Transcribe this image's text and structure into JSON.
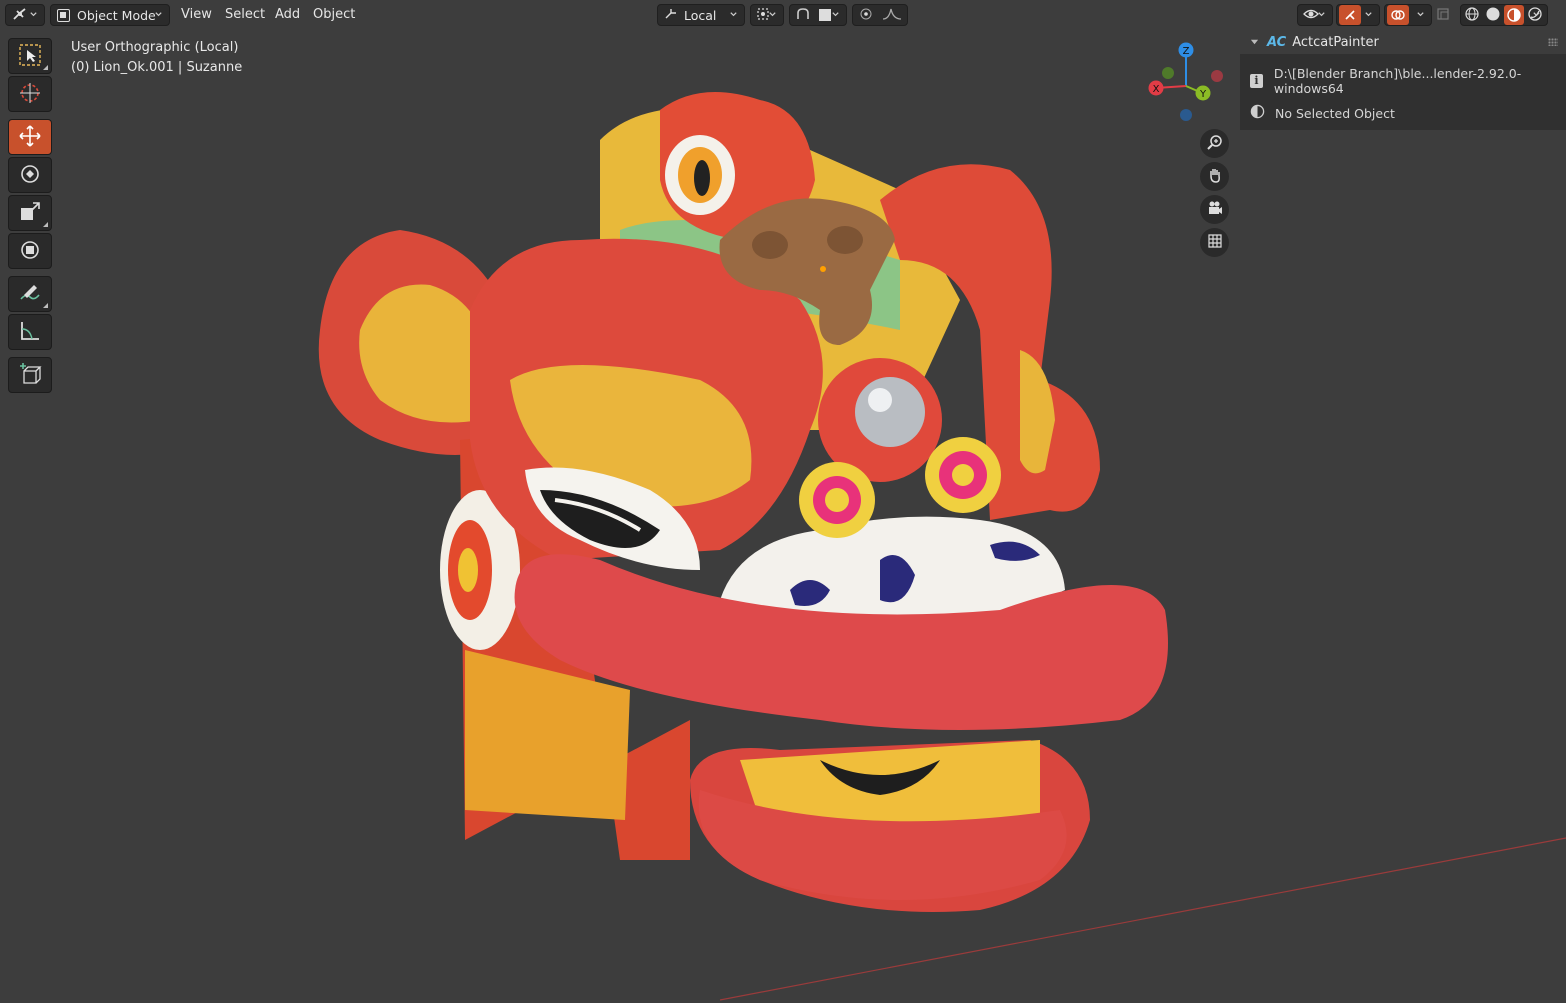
{
  "header": {
    "mode_label": "Object Mode",
    "menus": [
      "View",
      "Select",
      "Add",
      "Object"
    ],
    "orientation_label": "Local"
  },
  "overlay": {
    "view_name": "User Orthographic (Local)",
    "object_info": "(0) Lion_Ok.001 | Suzanne"
  },
  "gizmo": {
    "z_label": "Z",
    "y_label": "Y",
    "x_label": "X",
    "colors": {
      "x": "#e23c46",
      "y": "#8bbc25",
      "z": "#2e8ee6"
    }
  },
  "panel": {
    "title": "ActcatPainter",
    "logo_text": "AC",
    "path_text": "D:\\[Blender Branch]\\ble...lender-2.92.0-windows64",
    "status_text": "No Selected Object"
  },
  "toolbar": {
    "tools": [
      "select-box",
      "cursor",
      "move",
      "rotate",
      "scale",
      "transform",
      "annotate",
      "measure",
      "add-cube"
    ],
    "active_tool": "move"
  },
  "theme": {
    "accent": "#c8512c",
    "background": "#3d3d3d"
  }
}
